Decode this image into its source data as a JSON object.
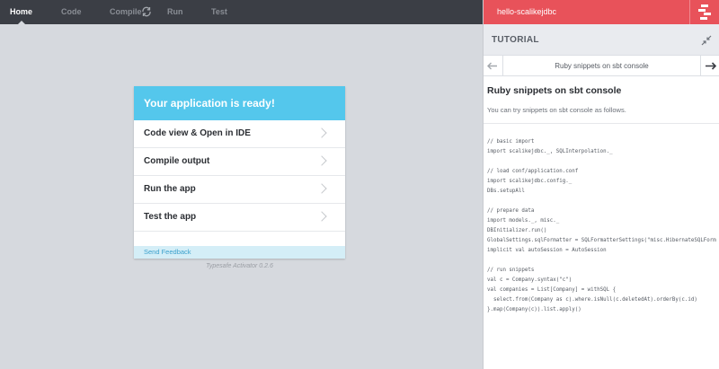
{
  "nav": {
    "items": [
      {
        "label": "Home",
        "active": true
      },
      {
        "label": "Code",
        "active": false
      },
      {
        "label": "Compile",
        "active": false
      },
      {
        "label": "Run",
        "active": false
      },
      {
        "label": "Test",
        "active": false
      }
    ],
    "compile_icon": "sync-icon"
  },
  "project": {
    "name": "hello-scalikejdbc",
    "logo_icon": "activator-logo-icon"
  },
  "card": {
    "title": "Your application is ready!",
    "rows": [
      {
        "label": "Code view & Open in IDE"
      },
      {
        "label": "Compile output"
      },
      {
        "label": "Run the app"
      },
      {
        "label": "Test the app"
      }
    ],
    "feedback": "Send Feedback"
  },
  "version": "Typesafe Activator 0.2.6",
  "tutorial": {
    "header": "TUTORIAL",
    "step": "Ruby snippets on sbt console",
    "heading": "Ruby snippets on sbt console",
    "intro": "You can try snippets on sbt console as follows.",
    "code": [
      "// basic import",
      "import scalikejdbc._, SQLInterpolation._",
      "",
      "// load conf/application.conf",
      "import scalikejdbc.config._",
      "DBs.setupAll",
      "",
      "// prepare data",
      "import models._, misc._",
      "DBInitializer.run()",
      "GlobalSettings.sqlFormatter = SQLFormatterSettings(\"misc.HibernateSQLForm",
      "implicit val autoSession = AutoSession",
      "",
      "// run snippets",
      "val c = Company.syntax(\"c\")",
      "val companies = List[Company] = withSQL {",
      "  select.from(Company as c).where.isNull(c.deletedAt).orderBy(c.id)",
      "}.map(Company(c)).list.apply()"
    ]
  },
  "colors": {
    "nav_bg": "#3b3e45",
    "accent_red": "#e8525a",
    "card_header": "#54c7ec",
    "page_bg": "#d6d9de"
  }
}
